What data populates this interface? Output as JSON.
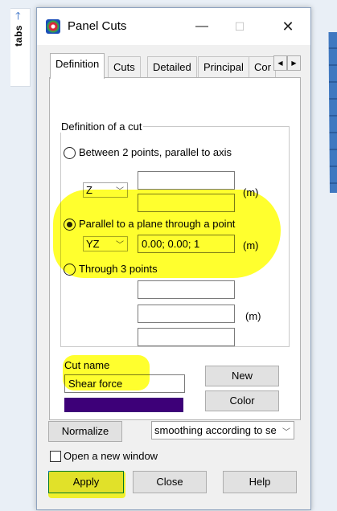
{
  "side_panel": {
    "arrow": "🡑",
    "label": "tabs"
  },
  "window": {
    "title": "Panel Cuts",
    "icon": "app-logo-icon",
    "minimize": "—",
    "maximize": "☐",
    "close": "✕"
  },
  "tabs": [
    {
      "label": "Definition",
      "active": true
    },
    {
      "label": "Cuts"
    },
    {
      "label": "Detailed"
    },
    {
      "label": "Principal"
    },
    {
      "label": "Cor"
    }
  ],
  "tab_scroll": {
    "left": "◀",
    "right": "▶"
  },
  "definition": {
    "group_title": "Definition of a cut",
    "option1": {
      "label": "Between 2 points, parallel to axis",
      "axis_value": "Z",
      "point1": "",
      "point2": "",
      "unit": "(m)"
    },
    "option2": {
      "label": "Parallel to a plane through a point",
      "selected": true,
      "plane_value": "YZ",
      "point": "0.00; 0.00; 1",
      "unit": "(m)"
    },
    "option3": {
      "label": "Through 3 points",
      "point1": "",
      "point2": "",
      "point3": "",
      "unit": "(m)"
    },
    "dropdown_arrow": "﹀"
  },
  "cut": {
    "name_label": "Cut name",
    "name_value": "Shear force",
    "new_button": "New",
    "color_button": "Color",
    "color": "#3d0078"
  },
  "bottom": {
    "normalize_button": "Normalize",
    "smoothing_value": "smoothing according to se",
    "open_window_label": "Open a new window",
    "open_window_checked": false,
    "apply_button": "Apply",
    "close_button": "Close",
    "help_button": "Help"
  },
  "colors": {
    "highlight": "#ffff00",
    "accent": "#0078d7"
  }
}
